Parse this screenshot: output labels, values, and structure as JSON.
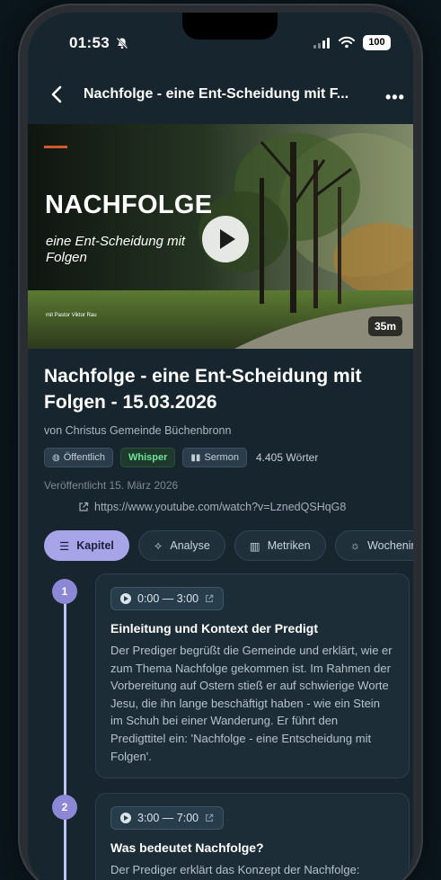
{
  "status_bar": {
    "time": "01:53",
    "battery": "100"
  },
  "navbar": {
    "title": "Nachfolge - eine Ent-Scheidung mit F...",
    "more_label": "•••"
  },
  "video": {
    "overlay_title": "NACHFOLGE",
    "overlay_subtitle": "eine Ent-Scheidung mit Folgen",
    "overlay_small": "mit Pastor Viktor Rau",
    "duration": "35m"
  },
  "sermon": {
    "title": "Nachfolge - eine Ent-Scheidung mit Folgen - 15.03.2026",
    "author": "von Christus Gemeinde Büchenbronn",
    "tags": {
      "visibility": "Öffentlich",
      "transcriber": "Whisper",
      "type": "Sermon",
      "word_count": "4.405 Wörter"
    },
    "published": "Veröffentlicht 15. März 2026",
    "url": "https://www.youtube.com/watch?v=LznedQSHqG8"
  },
  "tabs": [
    {
      "label": "Kapitel",
      "active": true
    },
    {
      "label": "Analyse",
      "active": false
    },
    {
      "label": "Metriken",
      "active": false
    },
    {
      "label": "Wochenin",
      "active": false
    }
  ],
  "chapters": [
    {
      "number": "1",
      "time": "0:00 — 3:00",
      "title": "Einleitung und Kontext der Predigt",
      "body": "Der Prediger begrüßt die Gemeinde und erklärt, wie er zum Thema Nachfolge gekommen ist. Im Rahmen der Vorbereitung auf Ostern stieß er auf schwierige Worte Jesu, die ihn lange beschäftigt haben - wie ein Stein im Schuh bei einer Wanderung. Er führt den Predigttitel ein: 'Nachfolge - eine Entscheidung mit Folgen'."
    },
    {
      "number": "2",
      "time": "3:00 — 7:00",
      "title": "Was bedeutet Nachfolge?",
      "body": "Der Prediger erklärt das Konzept der Nachfolge:"
    }
  ]
}
